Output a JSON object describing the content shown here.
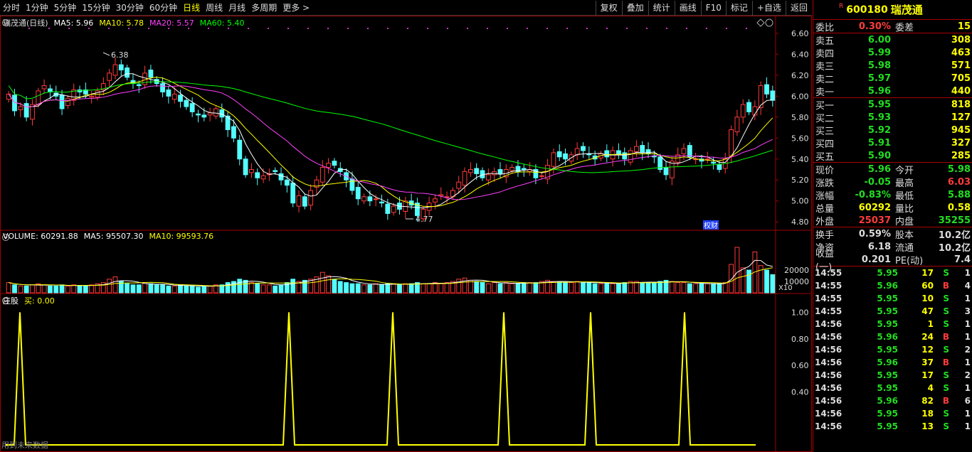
{
  "toolbar": {
    "periods": [
      "分时",
      "1分钟",
      "5分钟",
      "15分钟",
      "30分钟",
      "60分钟",
      "日线",
      "周线",
      "月线",
      "多周期",
      "更多"
    ],
    "selected": 6,
    "tools": [
      "复权",
      "叠加",
      "统计",
      "画线",
      "F10",
      "标记",
      "+自选",
      "返回"
    ]
  },
  "main_chart": {
    "title": "瑞茂通(日线)",
    "legend": [
      {
        "label": "MA5: 5.96",
        "color": "#ffffff"
      },
      {
        "label": "MA10: 5.78",
        "color": "#ffff00"
      },
      {
        "label": "MA20: 5.57",
        "color": "#ff40ff"
      },
      {
        "label": "MA60: 5.40",
        "color": "#00ff00"
      }
    ],
    "high_label": "6.38",
    "low_label": "4.77",
    "badge": "权财"
  },
  "volume_chart": {
    "legend": [
      {
        "label": "VOLUME: 60291.88",
        "color": "#ffffff"
      },
      {
        "label": "MA5: 95507.30",
        "color": "#ffffff"
      },
      {
        "label": "MA10: 99593.76",
        "color": "#ffff00"
      }
    ],
    "unit_label": "X10"
  },
  "indicator_chart": {
    "legend": [
      {
        "label": "庄股",
        "color": "#ffffff"
      },
      {
        "label": "买: 0.00",
        "color": "#ffff00"
      }
    ],
    "footer_text": "用到未来数据"
  },
  "chart_data": [
    {
      "type": "candlestick",
      "y_axis": [
        "6.60",
        "6.40",
        "6.20",
        "6.00",
        "5.80",
        "5.60",
        "5.40",
        "5.20",
        "5.00",
        "4.80"
      ],
      "ylim": [
        4.72,
        6.66
      ],
      "close": [
        6.02,
        5.86,
        5.9,
        5.8,
        5.92,
        6.05,
        6.1,
        6.04,
        6.0,
        5.88,
        5.98,
        6.06,
        6.04,
        6.02,
        6.0,
        6.05,
        6.12,
        6.22,
        6.3,
        6.25,
        6.18,
        6.12,
        6.1,
        6.22,
        6.18,
        6.12,
        6.04,
        6.0,
        6.02,
        5.95,
        5.9,
        5.85,
        5.82,
        5.8,
        5.84,
        5.88,
        5.8,
        5.68,
        5.6,
        5.4,
        5.25,
        5.3,
        5.22,
        5.24,
        5.26,
        5.28,
        5.2,
        5.15,
        4.98,
        5.05,
        4.95,
        5.1,
        5.2,
        5.32,
        5.36,
        5.34,
        5.28,
        5.2,
        5.1,
        5.02,
        5.04,
        5.0,
        5.02,
        4.98,
        4.88,
        4.95,
        4.92,
        5.0,
        4.96,
        4.86,
        4.92,
        4.98,
        5.02,
        5.06,
        5.04,
        5.1,
        5.18,
        5.28,
        5.3,
        5.26,
        5.22,
        5.25,
        5.28,
        5.26,
        5.3,
        5.32,
        5.28,
        5.3,
        5.3,
        5.22,
        5.24,
        5.34,
        5.46,
        5.42,
        5.4,
        5.44,
        5.5,
        5.48,
        5.44,
        5.4,
        5.45,
        5.42,
        5.48,
        5.44,
        5.4,
        5.48,
        5.52,
        5.46,
        5.45,
        5.42,
        5.3,
        5.25,
        5.38,
        5.44,
        5.5,
        5.42,
        5.4,
        5.38,
        5.4,
        5.36,
        5.3,
        5.4,
        5.68,
        5.8,
        5.92,
        5.85,
        5.9,
        6.1,
        6.02,
        5.96
      ],
      "volume": [
        9,
        7,
        6,
        6,
        7,
        8,
        7,
        6,
        6,
        7,
        6,
        7,
        6,
        6,
        7,
        8,
        9,
        12,
        14,
        10,
        8,
        7,
        7,
        9,
        8,
        7,
        7,
        6,
        6,
        7,
        6,
        6,
        5,
        6,
        6,
        7,
        7,
        9,
        10,
        12,
        11,
        9,
        8,
        7,
        7,
        6,
        7,
        9,
        12,
        10,
        11,
        12,
        14,
        18,
        15,
        12,
        10,
        9,
        8,
        8,
        7,
        7,
        8,
        7,
        8,
        8,
        7,
        8,
        8,
        9,
        8,
        8,
        9,
        8,
        9,
        10,
        12,
        13,
        11,
        10,
        9,
        8,
        9,
        8,
        9,
        8,
        8,
        9,
        9,
        9,
        10,
        11,
        10,
        10,
        9,
        9,
        10,
        9,
        9,
        8,
        8,
        9,
        8,
        8,
        9,
        10,
        10,
        9,
        9,
        9,
        10,
        11,
        10,
        9,
        9,
        8,
        8,
        8,
        8,
        8,
        8,
        9,
        25,
        40,
        22,
        20,
        36,
        24,
        20,
        16
      ],
      "buy_signal_x": [
        28,
        406,
        552,
        708,
        830,
        962
      ]
    }
  ],
  "panel": {
    "code": "600180",
    "name": "瑞茂通",
    "r_mark": "R",
    "weibi": {
      "label": "委比",
      "value": "0.30%",
      "label2": "委差",
      "value2": "15"
    },
    "orders": [
      {
        "label": "卖五",
        "price": "6.00",
        "vol": "308",
        "price_color": "green"
      },
      {
        "label": "卖四",
        "price": "5.99",
        "vol": "463",
        "price_color": "green"
      },
      {
        "label": "卖三",
        "price": "5.98",
        "vol": "571",
        "price_color": "green"
      },
      {
        "label": "卖二",
        "price": "5.97",
        "vol": "705",
        "price_color": "green"
      },
      {
        "label": "卖一",
        "price": "5.96",
        "vol": "440",
        "price_color": "green"
      },
      {
        "label": "买一",
        "price": "5.95",
        "vol": "818",
        "price_color": "green"
      },
      {
        "label": "买二",
        "price": "5.93",
        "vol": "127",
        "price_color": "green"
      },
      {
        "label": "买三",
        "price": "5.92",
        "vol": "945",
        "price_color": "green"
      },
      {
        "label": "买四",
        "price": "5.91",
        "vol": "327",
        "price_color": "green"
      },
      {
        "label": "买五",
        "price": "5.90",
        "vol": "285",
        "price_color": "green"
      }
    ],
    "quote": [
      {
        "l1": "现价",
        "v1": "5.96",
        "c1": "green",
        "l2": "今开",
        "v2": "5.98",
        "c2": "green"
      },
      {
        "l1": "涨跌",
        "v1": "-0.05",
        "c1": "green",
        "l2": "最高",
        "v2": "6.03",
        "c2": "red"
      },
      {
        "l1": "涨幅",
        "v1": "-0.83%",
        "c1": "green",
        "l2": "最低",
        "v2": "5.88",
        "c2": "green"
      },
      {
        "l1": "总量",
        "v1": "60292",
        "c1": "yellow",
        "l2": "量比",
        "v2": "0.58",
        "c2": "yellow"
      },
      {
        "l1": "外盘",
        "v1": "25037",
        "c1": "red",
        "l2": "内盘",
        "v2": "35255",
        "c2": "green"
      }
    ],
    "stats": [
      {
        "l1": "换手",
        "v1": "0.59%",
        "l2": "股本",
        "v2": "10.2亿"
      },
      {
        "l1": "净资",
        "v1": "6.18",
        "l2": "流通",
        "v2": "10.2亿"
      },
      {
        "l1": "收益(一)",
        "v1": "0.201",
        "l2": "PE(动)",
        "v2": "7.4"
      }
    ],
    "ticks": [
      {
        "t": "14:55",
        "p": "5.95",
        "v": "17",
        "d": "S",
        "n": "1"
      },
      {
        "t": "14:55",
        "p": "5.96",
        "v": "60",
        "d": "B",
        "n": "4"
      },
      {
        "t": "14:55",
        "p": "5.95",
        "v": "10",
        "d": "S",
        "n": "1"
      },
      {
        "t": "14:55",
        "p": "5.95",
        "v": "47",
        "d": "S",
        "n": "3"
      },
      {
        "t": "14:56",
        "p": "5.95",
        "v": "1",
        "d": "S",
        "n": "1"
      },
      {
        "t": "14:56",
        "p": "5.96",
        "v": "24",
        "d": "B",
        "n": "1"
      },
      {
        "t": "14:56",
        "p": "5.95",
        "v": "12",
        "d": "S",
        "n": "2"
      },
      {
        "t": "14:56",
        "p": "5.96",
        "v": "37",
        "d": "B",
        "n": "1"
      },
      {
        "t": "14:56",
        "p": "5.95",
        "v": "17",
        "d": "S",
        "n": "2"
      },
      {
        "t": "14:56",
        "p": "5.95",
        "v": "4",
        "d": "S",
        "n": "1"
      },
      {
        "t": "14:56",
        "p": "5.96",
        "v": "82",
        "d": "B",
        "n": "6"
      },
      {
        "t": "14:56",
        "p": "5.95",
        "v": "18",
        "d": "S",
        "n": "1"
      },
      {
        "t": "14:56",
        "p": "5.95",
        "v": "13",
        "d": "S",
        "n": "1"
      }
    ]
  },
  "colors": {
    "up": "#ff3b3b",
    "down": "#54ffff",
    "ma5": "#ffffff",
    "ma10": "#ffff00",
    "ma20": "#ff40ff",
    "ma60": "#00ff00",
    "grid": "#a00000"
  }
}
